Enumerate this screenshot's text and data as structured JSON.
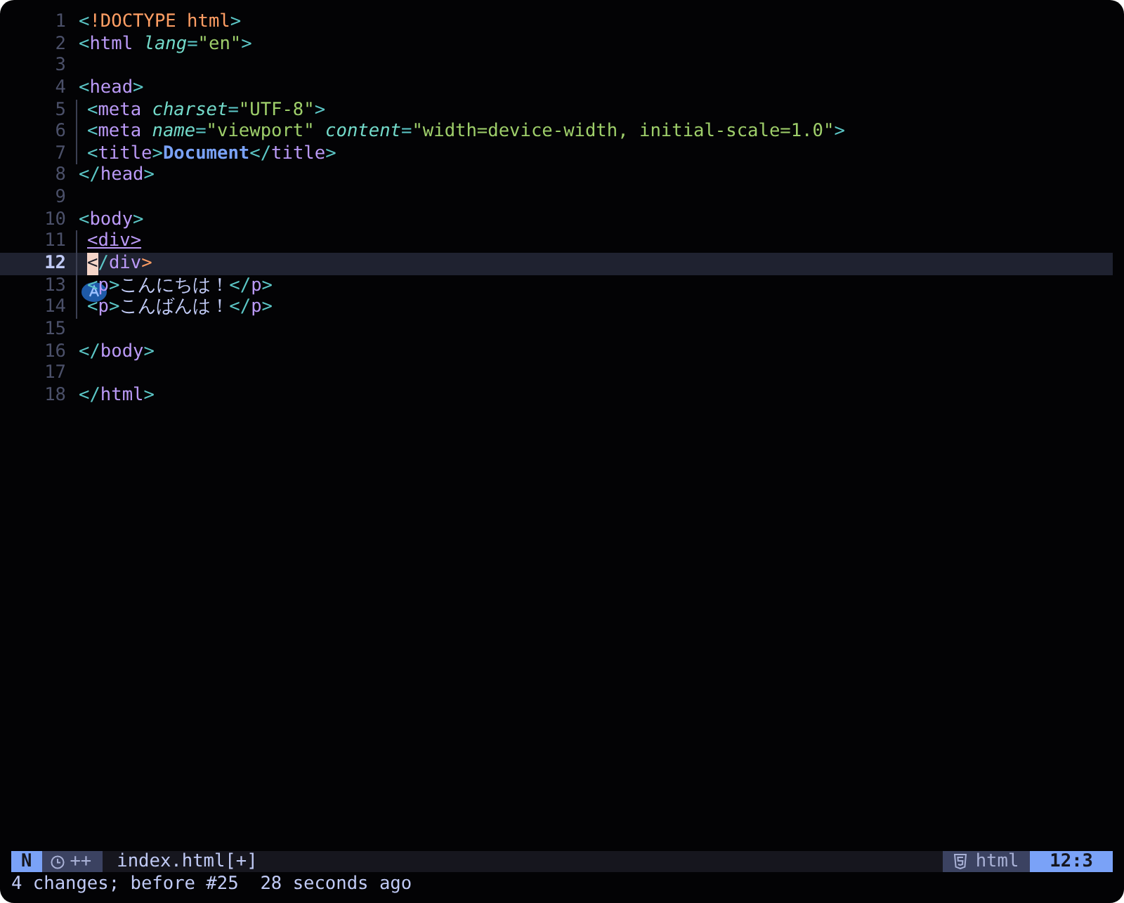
{
  "lines": [
    {
      "number": "1",
      "current": false,
      "guide": false,
      "tokens": [
        {
          "kind": "punct",
          "text": "<"
        },
        {
          "kind": "doctype",
          "text": "!DOCTYPE html"
        },
        {
          "kind": "punct",
          "text": ">"
        }
      ]
    },
    {
      "number": "2",
      "current": false,
      "guide": false,
      "tokens": [
        {
          "kind": "punct",
          "text": "<"
        },
        {
          "kind": "tag",
          "text": "html "
        },
        {
          "kind": "attr",
          "text": "lang"
        },
        {
          "kind": "punct",
          "text": "="
        },
        {
          "kind": "string",
          "text": "\"en\""
        },
        {
          "kind": "punct",
          "text": ">"
        }
      ]
    },
    {
      "number": "3",
      "current": false,
      "guide": false
    },
    {
      "number": "4",
      "current": false,
      "guide": false,
      "tokens": [
        {
          "kind": "punct",
          "text": "<"
        },
        {
          "kind": "tag",
          "text": "head"
        },
        {
          "kind": "punct",
          "text": ">"
        }
      ]
    },
    {
      "number": "5",
      "current": false,
      "guide": true,
      "tokens": [
        {
          "kind": "punct",
          "text": "<"
        },
        {
          "kind": "tag",
          "text": "meta "
        },
        {
          "kind": "attr",
          "text": "charset"
        },
        {
          "kind": "punct",
          "text": "="
        },
        {
          "kind": "string",
          "text": "\"UTF-8\""
        },
        {
          "kind": "punct",
          "text": ">"
        }
      ]
    },
    {
      "number": "6",
      "current": false,
      "guide": true,
      "tokens": [
        {
          "kind": "punct",
          "text": "<"
        },
        {
          "kind": "tag",
          "text": "meta "
        },
        {
          "kind": "attr",
          "text": "name"
        },
        {
          "kind": "punct",
          "text": "="
        },
        {
          "kind": "string",
          "text": "\"viewport\" "
        },
        {
          "kind": "attr",
          "text": "content"
        },
        {
          "kind": "punct",
          "text": "="
        },
        {
          "kind": "string",
          "text": "\"width=device-width, initial-scale=1.0\""
        },
        {
          "kind": "punct",
          "text": ">"
        }
      ]
    },
    {
      "number": "7",
      "current": false,
      "guide": true,
      "tokens": [
        {
          "kind": "punct",
          "text": "<"
        },
        {
          "kind": "tag",
          "text": "title"
        },
        {
          "kind": "punct",
          "text": ">"
        },
        {
          "kind": "title",
          "text": "Document"
        },
        {
          "kind": "punct",
          "text": "</"
        },
        {
          "kind": "tag",
          "text": "title"
        },
        {
          "kind": "punct",
          "text": ">"
        }
      ]
    },
    {
      "number": "8",
      "current": false,
      "guide": false,
      "tokens": [
        {
          "kind": "punct",
          "text": "</"
        },
        {
          "kind": "tag",
          "text": "head"
        },
        {
          "kind": "punct",
          "text": ">"
        }
      ]
    },
    {
      "number": "9",
      "current": false,
      "guide": false
    },
    {
      "number": "10",
      "current": false,
      "guide": false,
      "tokens": [
        {
          "kind": "punct",
          "text": "<"
        },
        {
          "kind": "tag",
          "text": "body"
        },
        {
          "kind": "punct",
          "text": ">"
        }
      ]
    },
    {
      "number": "11",
      "current": false,
      "guide": true,
      "tokens": [
        {
          "kind": "match",
          "text": "<div>"
        }
      ]
    },
    {
      "number": "12",
      "current": true,
      "guide": true,
      "tokens": [
        {
          "kind": "cursor",
          "text": "<"
        },
        {
          "kind": "punct",
          "text": "/"
        },
        {
          "kind": "tag",
          "text": "div"
        },
        {
          "kind": "bracket",
          "text": ">"
        }
      ]
    },
    {
      "number": "13",
      "current": false,
      "guide": true,
      "badge": true,
      "tokens": [
        {
          "kind": "punct",
          "text": "<"
        },
        {
          "kind": "tag",
          "text": "p"
        },
        {
          "kind": "punct",
          "text": ">"
        },
        {
          "kind": "text",
          "text": "こんにちは！"
        },
        {
          "kind": "punct",
          "text": "</"
        },
        {
          "kind": "tag",
          "text": "p"
        },
        {
          "kind": "punct",
          "text": ">"
        }
      ]
    },
    {
      "number": "14",
      "current": false,
      "guide": true,
      "tokens": [
        {
          "kind": "punct",
          "text": "<"
        },
        {
          "kind": "tag",
          "text": "p"
        },
        {
          "kind": "punct",
          "text": ">"
        },
        {
          "kind": "text",
          "text": "こんばんは！"
        },
        {
          "kind": "punct",
          "text": "</"
        },
        {
          "kind": "tag",
          "text": "p"
        },
        {
          "kind": "punct",
          "text": ">"
        }
      ]
    },
    {
      "number": "15",
      "current": false,
      "guide": false
    },
    {
      "number": "16",
      "current": false,
      "guide": false,
      "tokens": [
        {
          "kind": "punct",
          "text": "</"
        },
        {
          "kind": "tag",
          "text": "body"
        },
        {
          "kind": "punct",
          "text": ">"
        }
      ]
    },
    {
      "number": "17",
      "current": false,
      "guide": false
    },
    {
      "number": "18",
      "current": false,
      "guide": false,
      "tokens": [
        {
          "kind": "punct",
          "text": "</"
        },
        {
          "kind": "tag",
          "text": "html"
        },
        {
          "kind": "punct",
          "text": ">"
        }
      ]
    }
  ],
  "status_bar": {
    "mode": "N",
    "changes": "++",
    "file": "index.html[+]",
    "filetype": "html",
    "position": "12:3"
  },
  "message": "4 changes; before #25  28 seconds ago"
}
